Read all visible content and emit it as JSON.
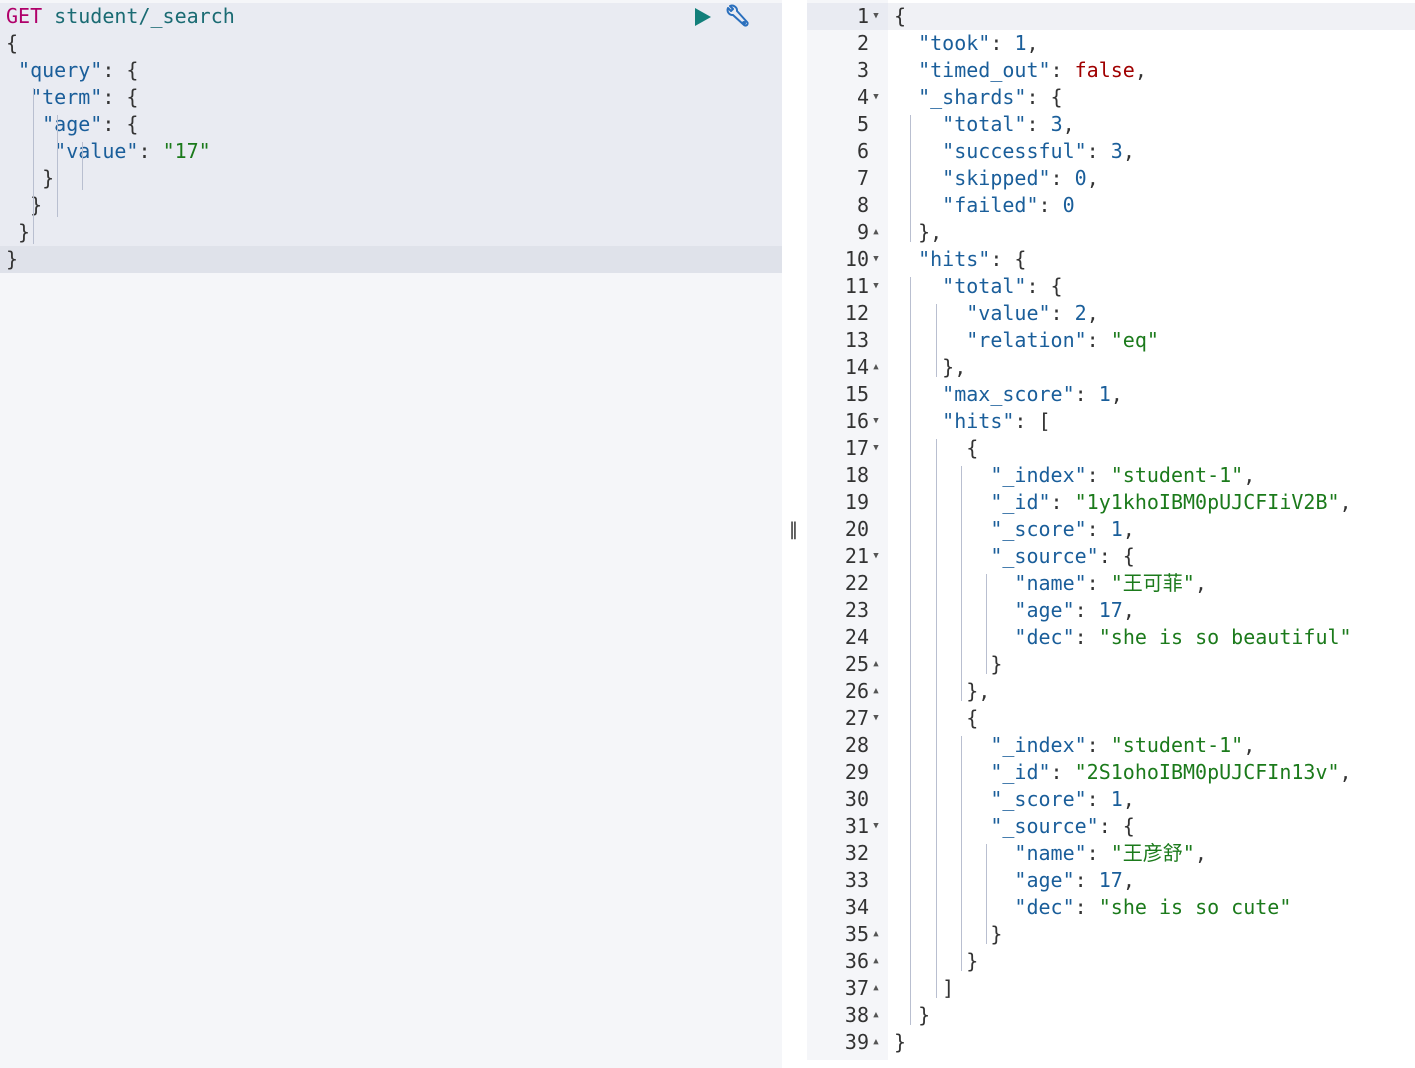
{
  "request": {
    "method": "GET",
    "url": "student/_search",
    "body_lines": [
      "{",
      " \"query\": {",
      "  \"term\": {",
      "   \"age\": {",
      "    \"value\": \"17\"",
      "   }",
      "  }",
      " }",
      "}"
    ]
  },
  "toolbar": {
    "run_icon": "play-icon",
    "settings_icon": "wrench-icon"
  },
  "divider": {
    "grip_label": "‖"
  },
  "response": {
    "line_numbers": [
      "1",
      "2",
      "3",
      "4",
      "5",
      "6",
      "7",
      "8",
      "9",
      "10",
      "11",
      "12",
      "13",
      "14",
      "15",
      "16",
      "17",
      "18",
      "19",
      "20",
      "21",
      "22",
      "23",
      "24",
      "25",
      "26",
      "27",
      "28",
      "29",
      "30",
      "31",
      "32",
      "33",
      "34",
      "35",
      "36",
      "37",
      "38",
      "39"
    ],
    "lines": [
      "{",
      "  \"took\": 1,",
      "  \"timed_out\": false,",
      "  \"_shards\": {",
      "    \"total\": 3,",
      "    \"successful\": 3,",
      "    \"skipped\": 0,",
      "    \"failed\": 0",
      "  },",
      "  \"hits\": {",
      "    \"total\": {",
      "      \"value\": 2,",
      "      \"relation\": \"eq\"",
      "    },",
      "    \"max_score\": 1,",
      "    \"hits\": [",
      "      {",
      "        \"_index\": \"student-1\",",
      "        \"_id\": \"1y1khoIBM0pUJCFIiV2B\",",
      "        \"_score\": 1,",
      "        \"_source\": {",
      "          \"name\": \"王可菲\",",
      "          \"age\": 17,",
      "          \"dec\": \"she is so beautiful\"",
      "        }",
      "      },",
      "      {",
      "        \"_index\": \"student-1\",",
      "        \"_id\": \"2S1ohoIBM0pUJCFIn13v\",",
      "        \"_score\": 1,",
      "        \"_source\": {",
      "          \"name\": \"王彦舒\",",
      "          \"age\": 17,",
      "          \"dec\": \"she is so cute\"",
      "        }",
      "      }",
      "    ]",
      "  }",
      "}"
    ],
    "folds": [
      "down",
      "",
      "",
      "down",
      "",
      "",
      "",
      "",
      "up",
      "down",
      "down",
      "",
      "",
      "up",
      "",
      "down",
      "down",
      "",
      "",
      "",
      "down",
      "",
      "",
      "",
      "up",
      "up",
      "down",
      "",
      "",
      "",
      "down",
      "",
      "",
      "",
      "up",
      "up",
      "up",
      "up",
      "up"
    ]
  },
  "colors": {
    "key": "#1a5e9a",
    "string": "#1b7a1b",
    "boolean": "#a00000",
    "method": "#b0006a",
    "url": "#1a6b73",
    "run_icon": "#127f7a",
    "settings_icon": "#2a6fbd"
  }
}
